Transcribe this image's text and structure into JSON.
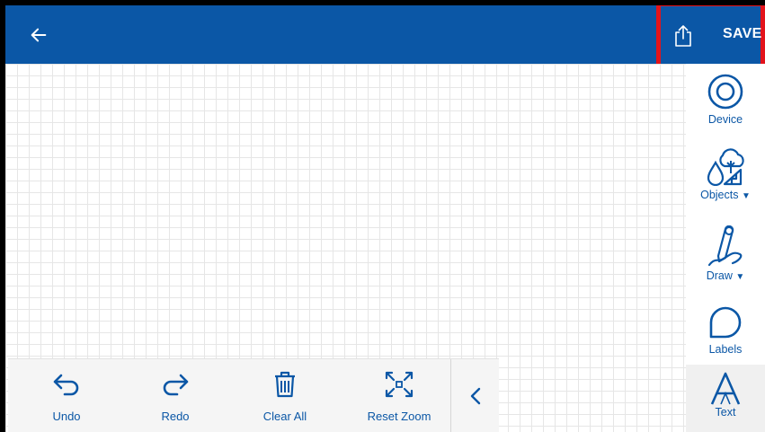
{
  "header": {
    "back_icon": "arrow-left-icon",
    "share_icon": "share-upload-icon",
    "save_label": "SAVE"
  },
  "sidebar": {
    "items": [
      {
        "label": "Device",
        "icon": "device-circle-icon",
        "has_dropdown": false
      },
      {
        "label": "Objects",
        "icon": "objects-tree-icon",
        "has_dropdown": true
      },
      {
        "label": "Draw",
        "icon": "draw-pen-icon",
        "has_dropdown": true
      },
      {
        "label": "Labels",
        "icon": "label-shape-icon",
        "has_dropdown": false
      },
      {
        "label": "Text",
        "icon": "text-a-icon",
        "has_dropdown": false,
        "active": true
      }
    ]
  },
  "toolbar": {
    "undo_label": "Undo",
    "redo_label": "Redo",
    "clear_label": "Clear All",
    "reset_zoom_label": "Reset Zoom",
    "collapse_icon": "chevron-left-icon"
  },
  "colors": {
    "brand": "#0b57a6",
    "highlight": "#e3131b",
    "grid": "#e6e6e6",
    "toolbar_bg": "#f5f5f5"
  }
}
